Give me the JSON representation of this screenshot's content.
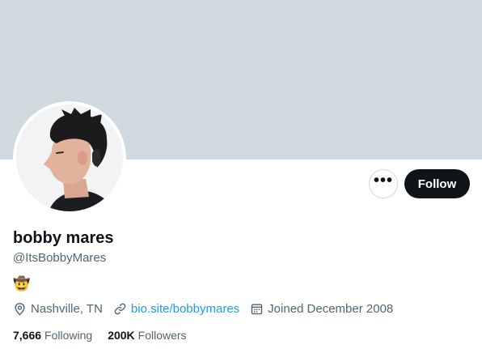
{
  "profile": {
    "display_name": "bobby mares",
    "handle": "@ItsBobbyMares",
    "bio": "🤠",
    "location": "Nashville, TN",
    "website": "bio.site/bobbymares",
    "joined": "Joined December 2008",
    "following_count": "7,666",
    "following_label": "Following",
    "followers_count": "200K",
    "followers_label": "Followers"
  },
  "actions": {
    "more_label": "•••",
    "follow_label": "Follow"
  },
  "colors": {
    "banner": "#cfd9de",
    "accent_link": "#1d9bf0",
    "follow_button": "#0f1419",
    "secondary_text": "#536471"
  },
  "icons": {
    "location": "location-pin-icon",
    "link": "link-icon",
    "calendar": "calendar-icon",
    "more": "more-dots-icon"
  }
}
